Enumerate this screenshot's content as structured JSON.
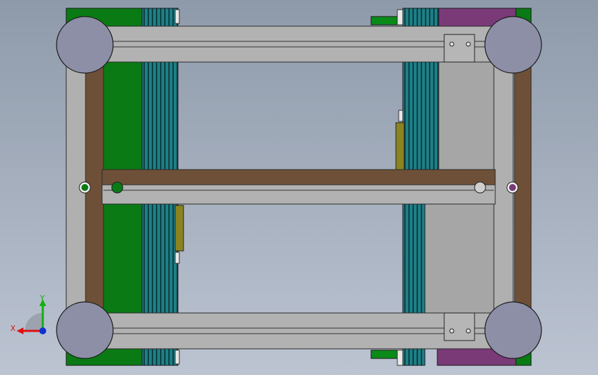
{
  "colors": {
    "background_top": "#8e9aaa",
    "background_bottom": "#bcc4d2",
    "frame_gray": "#a9a9a9",
    "rail_gray": "#b2b2b2",
    "brown": "#6e5038",
    "green": "#0a7a14",
    "purple": "#7a3a78",
    "teal": "#1f7f86",
    "olive": "#8a8420",
    "caster": "#8c8fa6",
    "axis_x": "#e01010",
    "axis_y": "#10b010",
    "axis_z": "#1030d0"
  },
  "icons": {
    "triad": "axis-triad-icon"
  },
  "axes": {
    "x_label": "X",
    "y_label": "Y"
  }
}
